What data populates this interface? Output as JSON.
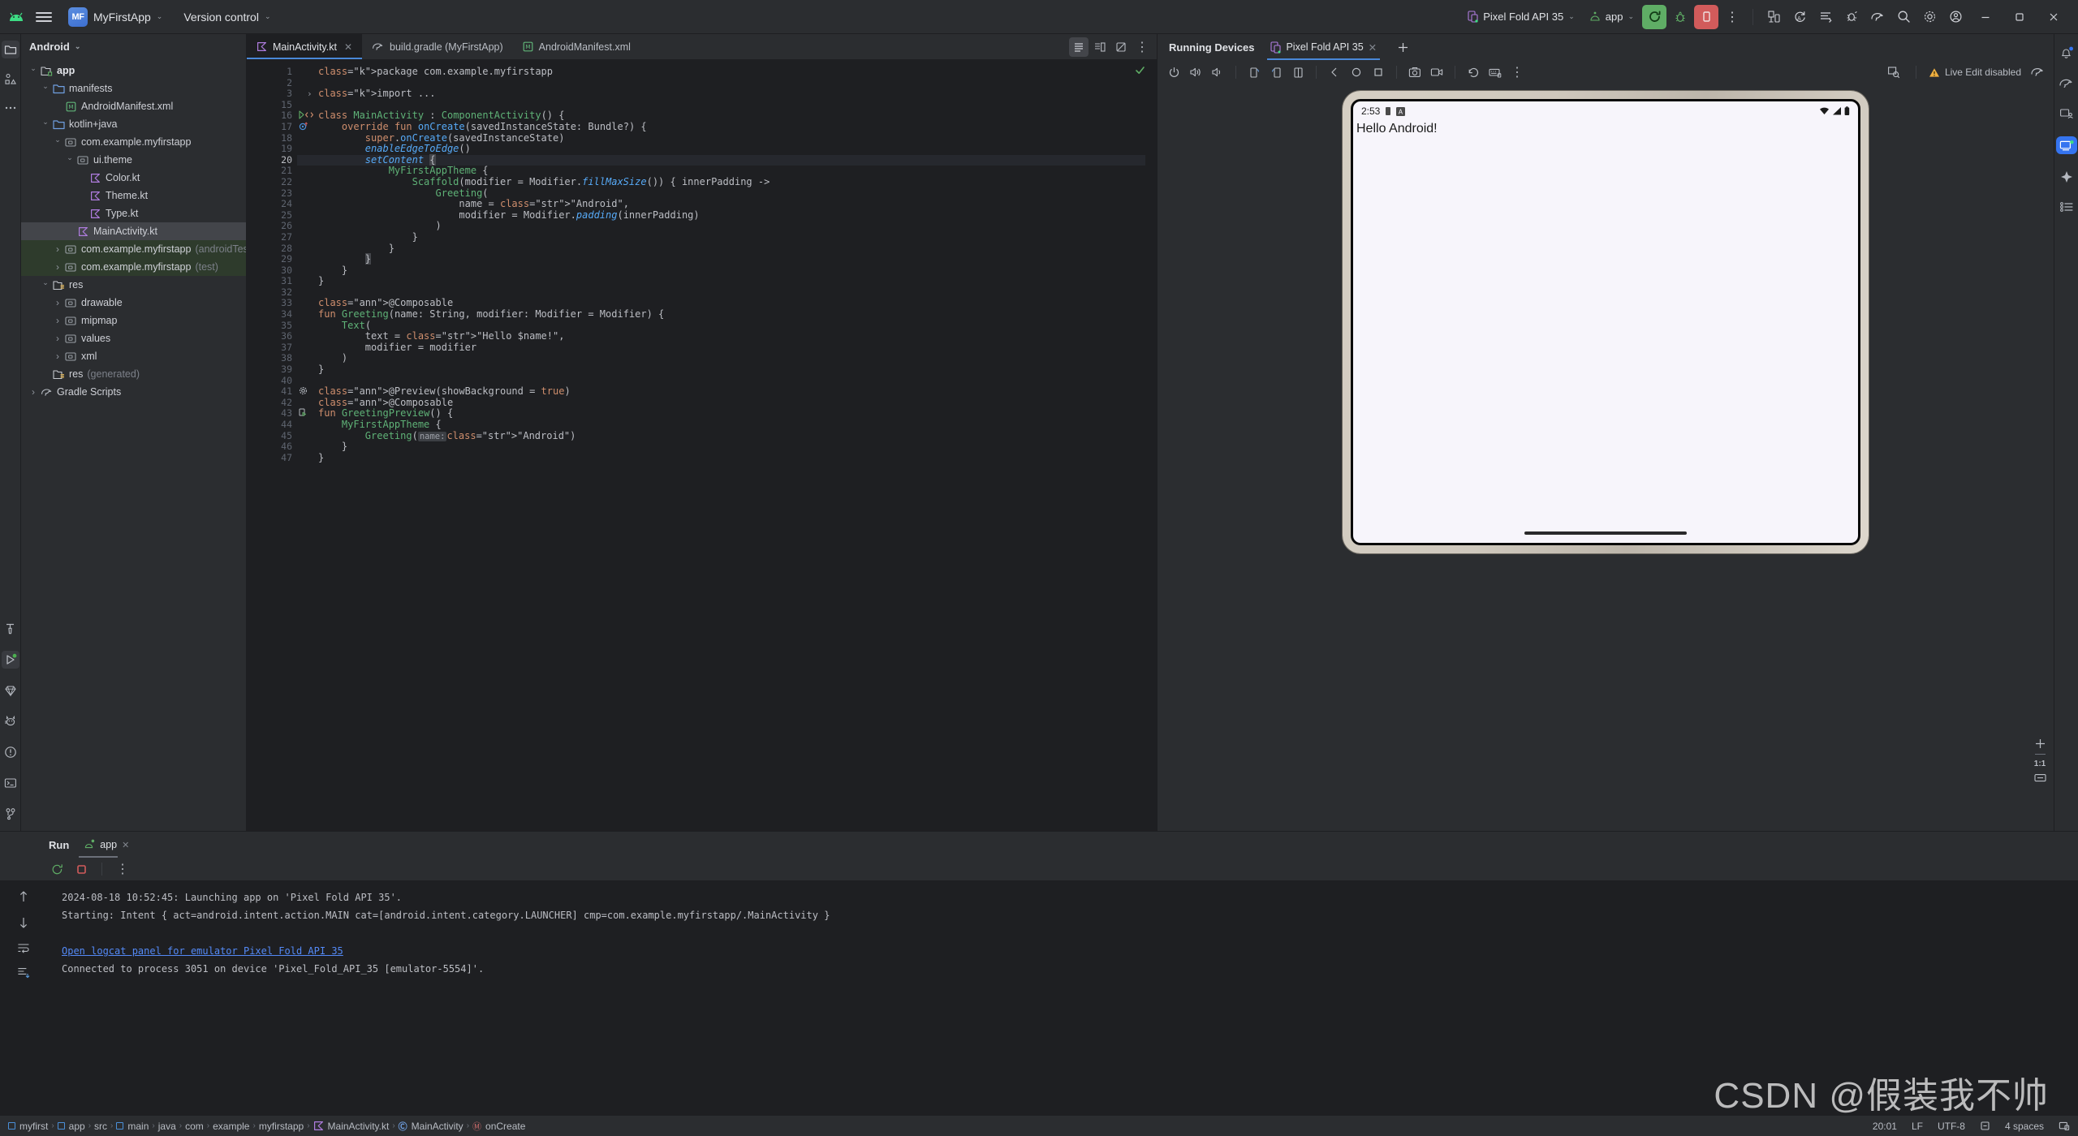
{
  "topbar": {
    "android_icon": "android-robot-icon",
    "menu_icon": "hamburger-menu-icon",
    "project_initials": "MF",
    "project_name": "MyFirstApp",
    "version_control": "Version control",
    "device_selector": "Pixel Fold API 35",
    "run_config": "app",
    "buttons": {
      "run": "run-icon",
      "debug": "debug-icon",
      "stop": "stop-icon",
      "more": "more-vertical-icon",
      "device_manager": "device-manager-icon",
      "sync": "gradle-sync-icon",
      "toggle": "toggle-list-icon",
      "profiler": "profiler-icon",
      "gradle": "gradle-elephant-icon",
      "search": "search-icon",
      "settings": "gear-icon",
      "account": "account-icon",
      "minimize": "minimize-icon",
      "maximize": "maximize-icon",
      "close": "close-icon"
    }
  },
  "left_rail": {
    "icons": [
      "project-folder-icon",
      "commit-shapes-icon",
      "more-dots-icon"
    ],
    "bottom_icons": [
      "build-hammer-icon",
      "run-play-icon",
      "gemini-diamond-icon",
      "logcat-cat-icon",
      "problems-icon",
      "terminal-icon",
      "version-control-branch-icon"
    ]
  },
  "project_panel": {
    "header": "Android",
    "tree": [
      {
        "label": "app",
        "indent": 0,
        "arrow": "open",
        "icon": "module-folder-icon",
        "bold": true,
        "selected": false,
        "suffix": ""
      },
      {
        "label": "manifests",
        "indent": 1,
        "arrow": "open",
        "icon": "folder-icon",
        "bold": false,
        "selected": false,
        "suffix": ""
      },
      {
        "label": "AndroidManifest.xml",
        "indent": 2,
        "arrow": "none",
        "icon": "manifest-xml-icon",
        "bold": false,
        "selected": false,
        "suffix": ""
      },
      {
        "label": "kotlin+java",
        "indent": 1,
        "arrow": "open",
        "icon": "folder-icon",
        "bold": false,
        "selected": false,
        "suffix": ""
      },
      {
        "label": "com.example.myfirstapp",
        "indent": 2,
        "arrow": "open",
        "icon": "package-icon",
        "bold": false,
        "selected": false,
        "suffix": ""
      },
      {
        "label": "ui.theme",
        "indent": 3,
        "arrow": "open",
        "icon": "package-icon",
        "bold": false,
        "selected": false,
        "suffix": ""
      },
      {
        "label": "Color.kt",
        "indent": 4,
        "arrow": "none",
        "icon": "kotlin-file-icon",
        "bold": false,
        "selected": false,
        "suffix": ""
      },
      {
        "label": "Theme.kt",
        "indent": 4,
        "arrow": "none",
        "icon": "kotlin-file-icon",
        "bold": false,
        "selected": false,
        "suffix": ""
      },
      {
        "label": "Type.kt",
        "indent": 4,
        "arrow": "none",
        "icon": "kotlin-file-icon",
        "bold": false,
        "selected": false,
        "suffix": ""
      },
      {
        "label": "MainActivity.kt",
        "indent": 3,
        "arrow": "none",
        "icon": "kotlin-file-icon",
        "bold": false,
        "selected": true,
        "suffix": ""
      },
      {
        "label": "com.example.myfirstapp",
        "indent": 2,
        "arrow": "closed",
        "icon": "package-icon",
        "bold": false,
        "selected": false,
        "suffix": "(androidTest)",
        "testgroup": true
      },
      {
        "label": "com.example.myfirstapp",
        "indent": 2,
        "arrow": "closed",
        "icon": "package-icon",
        "bold": false,
        "selected": false,
        "suffix": "(test)",
        "testgroup": true
      },
      {
        "label": "res",
        "indent": 1,
        "arrow": "open",
        "icon": "res-folder-icon",
        "bold": false,
        "selected": false,
        "suffix": ""
      },
      {
        "label": "drawable",
        "indent": 2,
        "arrow": "closed",
        "icon": "package-icon",
        "bold": false,
        "selected": false,
        "suffix": ""
      },
      {
        "label": "mipmap",
        "indent": 2,
        "arrow": "closed",
        "icon": "package-icon",
        "bold": false,
        "selected": false,
        "suffix": ""
      },
      {
        "label": "values",
        "indent": 2,
        "arrow": "closed",
        "icon": "package-icon",
        "bold": false,
        "selected": false,
        "suffix": ""
      },
      {
        "label": "xml",
        "indent": 2,
        "arrow": "closed",
        "icon": "package-icon",
        "bold": false,
        "selected": false,
        "suffix": ""
      },
      {
        "label": "res",
        "indent": 1,
        "arrow": "none",
        "icon": "res-folder-icon",
        "bold": false,
        "selected": false,
        "suffix": "(generated)"
      },
      {
        "label": "Gradle Scripts",
        "indent": 0,
        "arrow": "closed",
        "icon": "gradle-elephant-icon",
        "bold": false,
        "selected": false,
        "suffix": ""
      }
    ]
  },
  "editor": {
    "tabs": [
      {
        "label": "MainActivity.kt",
        "icon": "kotlin-file-icon",
        "active": true,
        "closable": true
      },
      {
        "label": "build.gradle (MyFirstApp)",
        "icon": "gradle-elephant-icon",
        "active": false,
        "closable": false
      },
      {
        "label": "AndroidManifest.xml",
        "icon": "manifest-xml-icon",
        "active": false,
        "closable": false
      }
    ],
    "view_buttons": [
      "code-view-icon",
      "split-view-icon",
      "design-view-icon",
      "more-vertical-icon"
    ],
    "inspection_status": "check-ok-icon",
    "line_numbers": [
      1,
      2,
      3,
      15,
      16,
      17,
      18,
      19,
      20,
      21,
      22,
      23,
      24,
      25,
      26,
      27,
      28,
      29,
      30,
      31,
      32,
      33,
      34,
      35,
      36,
      37,
      38,
      39,
      40,
      41,
      42,
      43,
      44,
      45,
      46,
      47
    ],
    "gutter_marks": {
      "16": "run-gutter-icon",
      "17": "override-gutter-icon",
      "41": "preview-gear-icon",
      "43": "preview-run-icon"
    },
    "highlighted_line": 20,
    "code_lines": [
      "package com.example.myfirstapp",
      "",
      "import ...",
      "",
      "class MainActivity : ComponentActivity() {",
      "    override fun onCreate(savedInstanceState: Bundle?) {",
      "        super.onCreate(savedInstanceState)",
      "        enableEdgeToEdge()",
      "        setContent {",
      "            MyFirstAppTheme {",
      "                Scaffold(modifier = Modifier.fillMaxSize()) { innerPadding ->",
      "                    Greeting(",
      "                        name = \"Android\",",
      "                        modifier = Modifier.padding(innerPadding)",
      "                    )",
      "                }",
      "            }",
      "        }",
      "    }",
      "}",
      "",
      "@Composable",
      "fun Greeting(name: String, modifier: Modifier = Modifier) {",
      "    Text(",
      "        text = \"Hello $name!\",",
      "        modifier = modifier",
      "    )",
      "}",
      "",
      "@Preview(showBackground = true)",
      "@Composable",
      "fun GreetingPreview() {",
      "    MyFirstAppTheme {",
      "        Greeting( name: \"Android\")",
      "    }",
      "}"
    ]
  },
  "running_devices": {
    "panel_title": "Running Devices",
    "tab_label": "Pixel Fold API 35",
    "tab_icon": "device-phone-icon",
    "add_tab_icon": "plus-icon",
    "close_tab_icon": "close-icon",
    "toolbar_icons": [
      "power-icon",
      "volume-up-icon",
      "volume-down-icon",
      "rotate-left-icon",
      "rotate-right-icon",
      "fold-icon",
      "back-icon",
      "home-icon",
      "overview-icon",
      "screenshot-icon",
      "record-icon",
      "undo-icon",
      "keyboard-icon",
      "more-vertical-icon"
    ],
    "inspect_icon": "layout-inspector-icon",
    "live_edit_status": "Live Edit disabled",
    "live_edit_warning_icon": "warning-triangle-icon",
    "gradle_icon": "gradle-elephant-icon",
    "zoom_label": "1:1",
    "zoom_in_icon": "plus-icon",
    "zoom_fit_icon": "fit-screen-icon",
    "emulator": {
      "status_time": "2:53",
      "status_icons": [
        "battery-small-icon",
        "a-badge-icon"
      ],
      "signal_icons": [
        "wifi-icon",
        "cellular-icon",
        "battery-icon"
      ],
      "app_text": "Hello Android!"
    }
  },
  "right_rail": {
    "icons": [
      "notifications-bell-icon",
      "gradle-elephant-icon",
      "device-manager-icon",
      "running-devices-icon",
      "gemini-diamond-icon",
      "structure-list-icon"
    ]
  },
  "run_panel": {
    "title": "Run",
    "tab_label": "app",
    "tab_icon": "android-app-icon",
    "close_icon": "close-icon",
    "toolbar_icons": [
      "rerun-icon",
      "stop-icon",
      "more-vertical-icon"
    ],
    "rail_icons": [
      "scroll-up-icon",
      "scroll-down-icon",
      "soft-wrap-icon",
      "scroll-to-end-icon"
    ],
    "log_lines": [
      {
        "text": "2024-08-18 10:52:45: Launching app on 'Pixel Fold API 35'.",
        "link": false
      },
      {
        "text": "Starting: Intent { act=android.intent.action.MAIN cat=[android.intent.category.LAUNCHER] cmp=com.example.myfirstapp/.MainActivity }",
        "link": false
      },
      {
        "text": "",
        "link": false
      },
      {
        "text": "Open logcat panel for emulator Pixel Fold API 35",
        "link": true
      },
      {
        "text": "Connected to process 3051 on device 'Pixel_Fold_API_35 [emulator-5554]'.",
        "link": false
      }
    ]
  },
  "status_bar": {
    "breadcrumbs": [
      {
        "label": "myfirst",
        "icon": "module-icon"
      },
      {
        "label": "app",
        "icon": "module-icon"
      },
      {
        "label": "src",
        "icon": "none"
      },
      {
        "label": "main",
        "icon": "module-icon"
      },
      {
        "label": "java",
        "icon": "none"
      },
      {
        "label": "com",
        "icon": "none"
      },
      {
        "label": "example",
        "icon": "none"
      },
      {
        "label": "myfirstapp",
        "icon": "none"
      },
      {
        "label": "MainActivity.kt",
        "icon": "kotlin-file-icon"
      },
      {
        "label": "MainActivity",
        "icon": "class-icon"
      },
      {
        "label": "onCreate",
        "icon": "method-icon"
      }
    ],
    "caret_position": "20:01",
    "line_separator": "LF",
    "encoding": "UTF-8",
    "indent": "4 spaces",
    "lock_icon": "read-only-icon",
    "layout_icon": "layout-icon"
  },
  "watermark": "CSDN @假装我不帅",
  "colors": {
    "bg_panel": "#2b2d30",
    "bg_editor": "#1e1f22",
    "accent_blue": "#3574f0",
    "run_green": "#5fad65",
    "stop_red": "#d15b5b",
    "warning_yellow": "#f0b041",
    "selection": "#43454a",
    "test_group": "#2e3b2c"
  }
}
